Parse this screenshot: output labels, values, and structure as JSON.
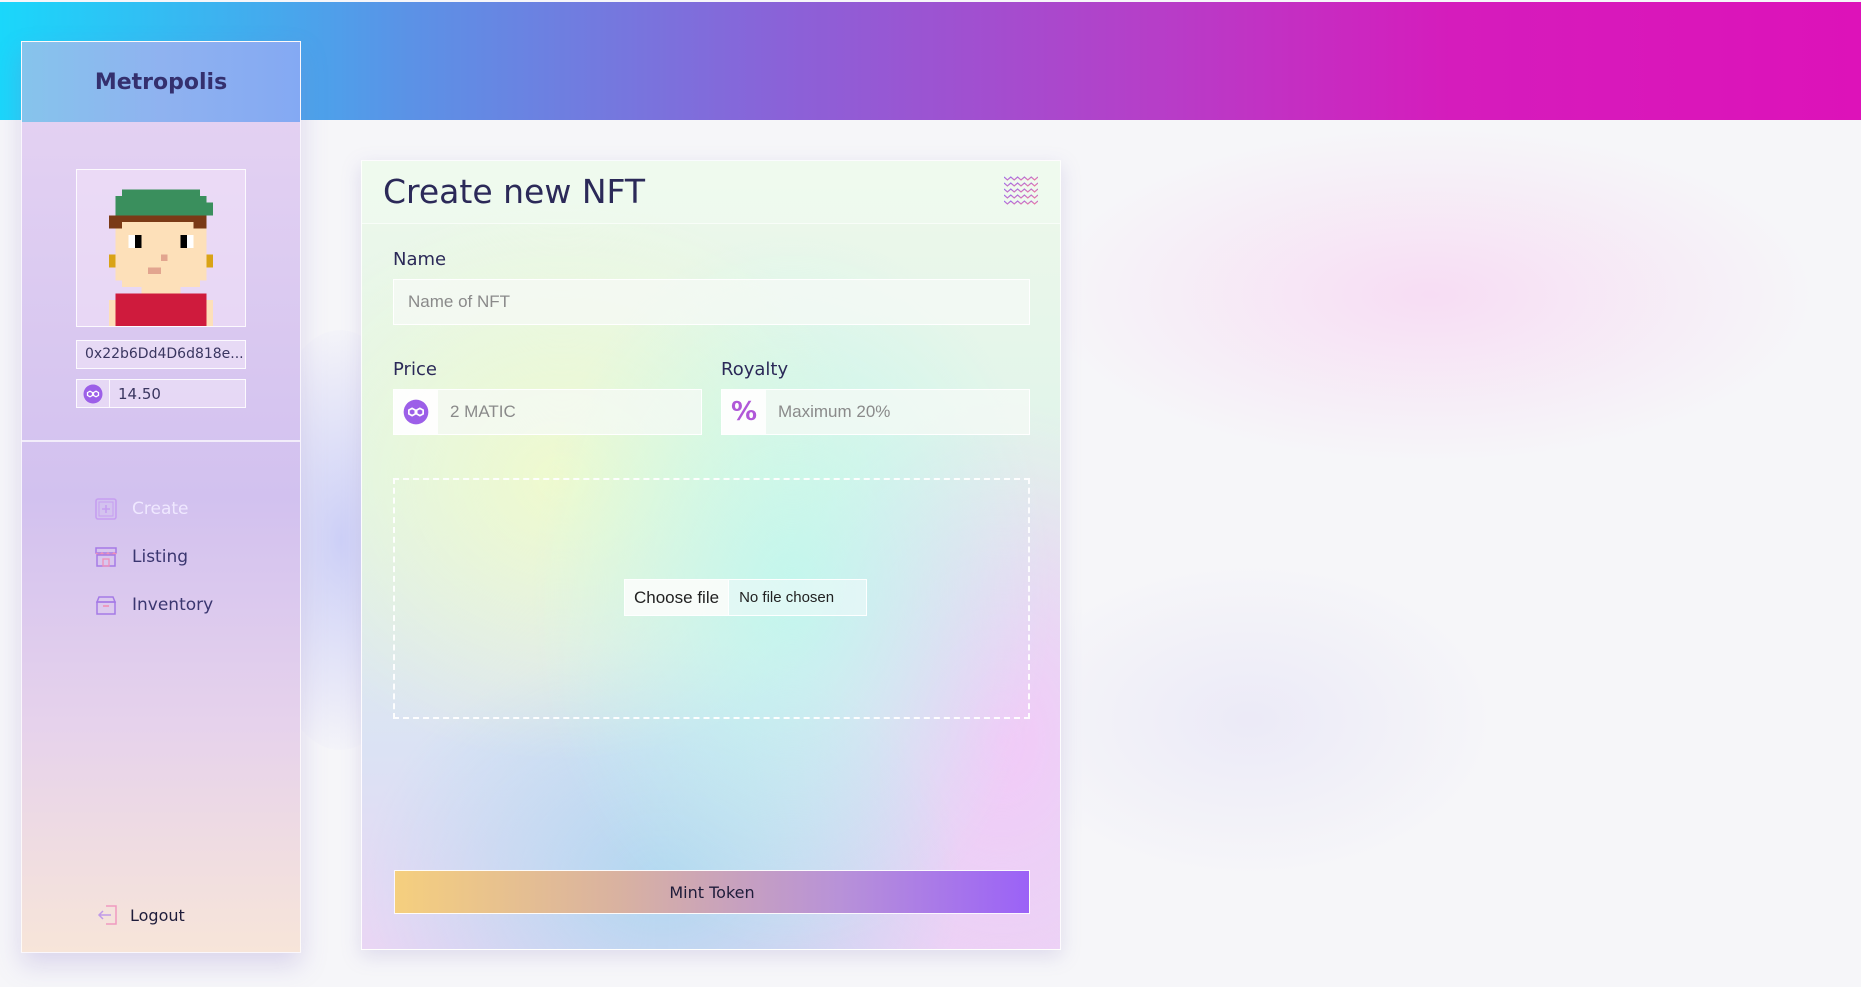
{
  "app": {
    "brand": "Metropolis",
    "accent_colors": {
      "banner_start": "#1ad7fb",
      "banner_end": "#dd12b9",
      "title_text": "#2b2958",
      "button_gradient_start": "#f5cf7e",
      "button_gradient_end": "#9b62f7"
    }
  },
  "sidebar": {
    "wallet_address": "0x22b6Dd4D6d818e...",
    "balance": "14.50",
    "balance_icon": "polygon-icon",
    "nav_items": [
      {
        "label": "Create",
        "icon": "create-square-icon",
        "active": true
      },
      {
        "label": "Listing",
        "icon": "storefront-icon",
        "active": false
      },
      {
        "label": "Inventory",
        "icon": "box-icon",
        "active": false
      }
    ],
    "logout_label": "Logout",
    "logout_icon": "logout-icon"
  },
  "form": {
    "title": "Create new NFT",
    "header_icon": "wave-pattern-icon",
    "name_label": "Name",
    "name_placeholder": "Name of NFT",
    "price_label": "Price",
    "price_placeholder": "2 MATIC",
    "price_icon": "polygon-icon",
    "royalty_label": "Royalty",
    "royalty_placeholder": "Maximum 20%",
    "royalty_symbol": "%",
    "file_button_label": "Choose file",
    "file_status": "No file chosen",
    "submit_label": "Mint Token"
  }
}
